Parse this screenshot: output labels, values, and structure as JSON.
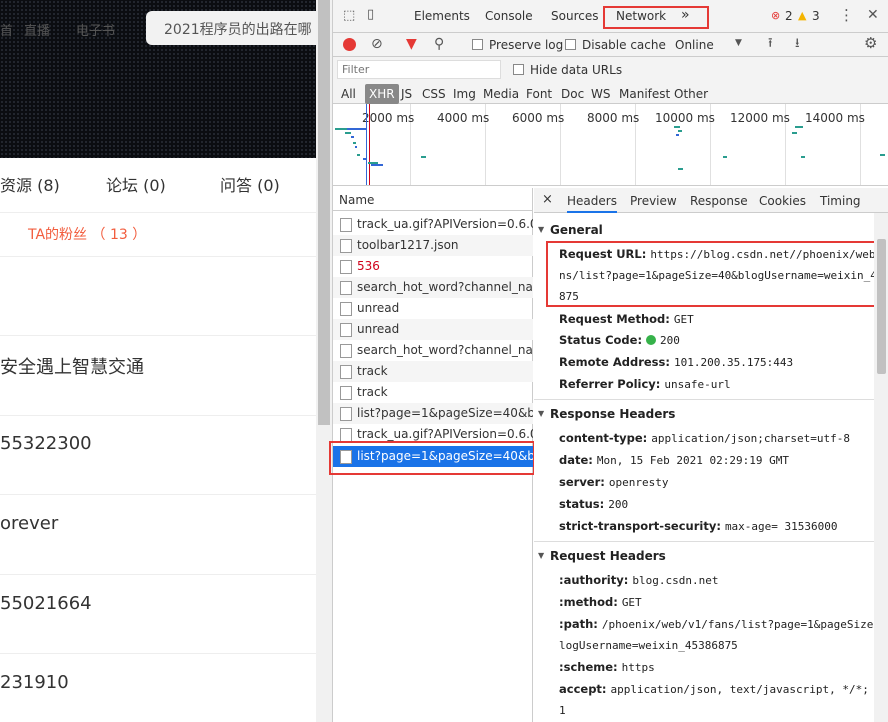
{
  "left_page": {
    "nav_partial": [
      "首",
      "直播",
      "电子书"
    ],
    "search_placeholder": "2021程序员的出路在哪",
    "tabs": [
      "资源 (8)",
      "论坛 (0)",
      "问答 (0)"
    ],
    "fans_link": "TA的粉丝 （ 13 ）",
    "rows": [
      "安全遇上智慧交通",
      "55322300",
      "orever",
      "55021664",
      "231910"
    ]
  },
  "devtools": {
    "main_tabs": [
      "Elements",
      "Console",
      "Sources",
      "Network"
    ],
    "more": "»",
    "errors": "2",
    "warnings": "3",
    "toolbar": {
      "preserve_log": "Preserve log",
      "disable_cache": "Disable cache",
      "throttle": "Online"
    },
    "filter_placeholder": "Filter",
    "hide_data_urls": "Hide data URLs",
    "type_filters": [
      "All",
      "XHR",
      "JS",
      "CSS",
      "Img",
      "Media",
      "Font",
      "Doc",
      "WS",
      "Manifest",
      "Other"
    ],
    "timeline_labels": [
      "2000 ms",
      "4000 ms",
      "6000 ms",
      "8000 ms",
      "10000 ms",
      "12000 ms",
      "14000 ms"
    ],
    "name_header": "Name",
    "requests": [
      "track_ua.gif?APIVersion=0.6.0...",
      "toolbar1217.json",
      "536",
      "search_hot_word?channel_na...",
      "unread",
      "unread",
      "search_hot_word?channel_na...",
      "track",
      "track",
      "list?page=1&pageSize=40&bl...",
      "track_ua.gif?APIVersion=0.6.0...",
      "list?page=1&pageSize=40&bl..."
    ],
    "detail_tabs": [
      "×",
      "Headers",
      "Preview",
      "Response",
      "Cookies",
      "Timing"
    ],
    "general": {
      "title": "General",
      "request_url_label": "Request URL:",
      "request_url_l1": "https://blog.csdn.net//phoenix/web/",
      "request_url_l2": "ns/list?page=1&pageSize=40&blogUsername=weixin_4",
      "request_url_l3": "875",
      "method_label": "Request Method:",
      "method": "GET",
      "status_label": "Status Code:",
      "status": "200",
      "remote_label": "Remote Address:",
      "remote": "101.200.35.175:443",
      "referrer_label": "Referrer Policy:",
      "referrer": "unsafe-url"
    },
    "response_headers": {
      "title": "Response Headers",
      "content_type_label": "content-type:",
      "content_type": "application/json;charset=utf-8",
      "date_label": "date:",
      "date": "Mon, 15 Feb 2021 02:29:19 GMT",
      "server_label": "server:",
      "server": "openresty",
      "status_label": "status:",
      "status": "200",
      "sts_label": "strict-transport-security:",
      "sts": "max-age= 31536000"
    },
    "request_headers": {
      "title": "Request Headers",
      "authority_label": ":authority:",
      "authority": "blog.csdn.net",
      "method_label": ":method:",
      "method": "GET",
      "path_label": ":path:",
      "path_l1": "/phoenix/web/v1/fans/list?page=1&pageSize",
      "path_l2": "logUsername=weixin_45386875",
      "scheme_label": ":scheme:",
      "scheme": "https",
      "accept_label": "accept:",
      "accept": "application/json, text/javascript, */*; q",
      "accept_l2": "1"
    },
    "colors": {
      "record_red": "#e53935",
      "selected_blue": "#1a73e8",
      "status_green": "#36b24a",
      "highlight_red": "#e53935"
    }
  }
}
